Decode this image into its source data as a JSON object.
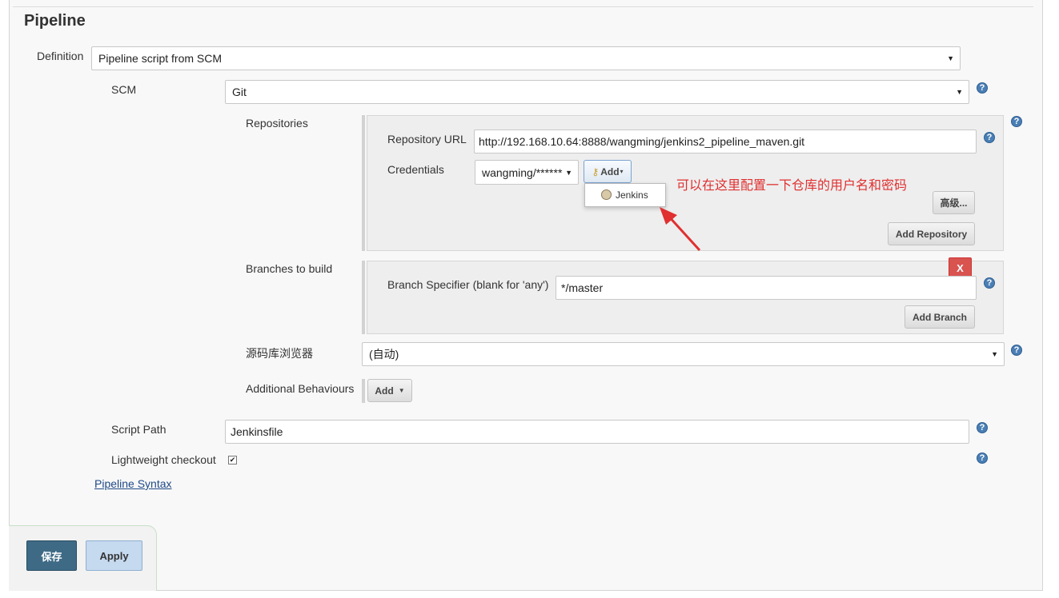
{
  "section_title": "Pipeline",
  "definition": {
    "label": "Definition",
    "value": "Pipeline script from SCM"
  },
  "scm": {
    "label": "SCM",
    "value": "Git"
  },
  "repositories": {
    "label": "Repositories",
    "url_label": "Repository URL",
    "url_value": "http://192.168.10.64:8888/wangming/jenkins2_pipeline_maven.git",
    "credentials_label": "Credentials",
    "credentials_value": "wangming/******",
    "add_label": "Add",
    "dropdown_item": "Jenkins",
    "advanced_label": "高级...",
    "add_repository_label": "Add Repository"
  },
  "annotation": "可以在这里配置一下仓库的用户名和密码",
  "branches": {
    "label": "Branches to build",
    "specifier_label": "Branch Specifier (blank for 'any')",
    "specifier_value": "*/master",
    "delete_label": "X",
    "add_branch_label": "Add Branch"
  },
  "repo_browser": {
    "label": "源码库浏览器",
    "value": "(自动)"
  },
  "additional_behaviours": {
    "label": "Additional Behaviours",
    "add_label": "Add"
  },
  "script_path": {
    "label": "Script Path",
    "value": "Jenkinsfile"
  },
  "lightweight": {
    "label": "Lightweight checkout",
    "checked": true
  },
  "pipeline_syntax_link": "Pipeline Syntax",
  "footer": {
    "save_label": "保存",
    "apply_label": "Apply"
  },
  "colors": {
    "annotation_red": "#e03030",
    "save_blue": "#3e6a86",
    "apply_blue": "#c5d9ef",
    "delete_red": "#d9534f"
  }
}
